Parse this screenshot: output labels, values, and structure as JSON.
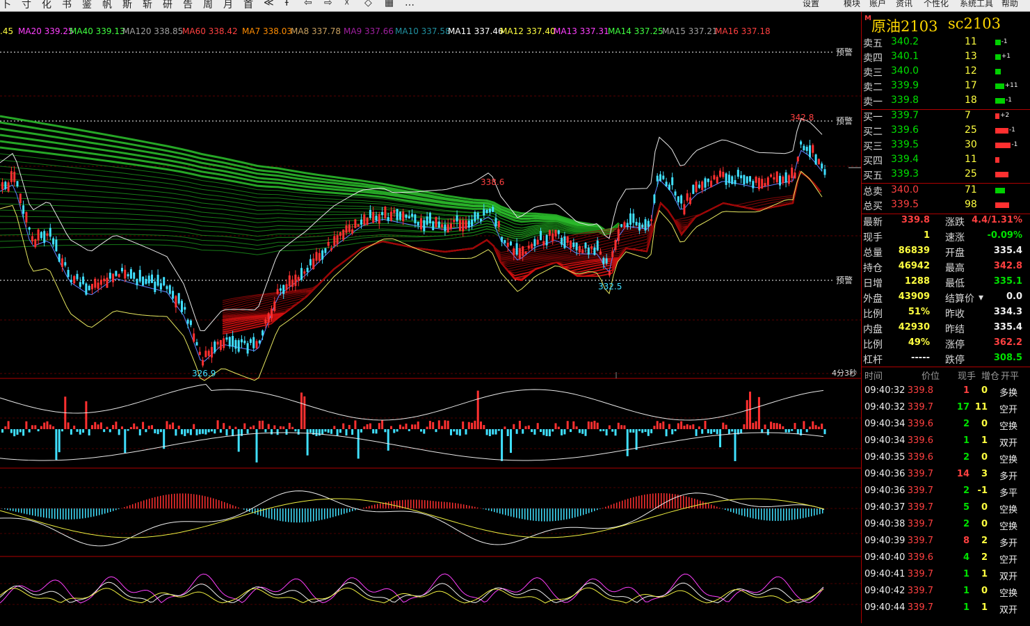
{
  "toolbar": {
    "items": [
      "卜",
      "寸",
      "化",
      "书",
      "鉴",
      "帆",
      "斯",
      "斩",
      "研",
      "告",
      "周",
      "月",
      "首",
      "≪",
      "Ŧ",
      "⇦",
      "⇨",
      "☓",
      "◇",
      "▦",
      "…"
    ],
    "right_items": [
      "设置",
      "模块",
      "账户",
      "资讯",
      "个性化",
      "系统工具",
      "帮助"
    ]
  },
  "ma_legend": [
    {
      "label": ".45",
      "color": "#ffff40"
    },
    {
      "label": "MA20 339.25",
      "color": "#ff40ff"
    },
    {
      "label": "MA40 339.13",
      "color": "#40ff40"
    },
    {
      "label": "MA120 338.85",
      "color": "#a0a0a0"
    },
    {
      "label": "MA60 338.42",
      "color": "#ff4040"
    },
    {
      "label": "MA7 338.03",
      "color": "#ff8c00"
    },
    {
      "label": "MA8 337.78",
      "color": "#c8a060"
    },
    {
      "label": "MA9 337.66",
      "color": "#a020a0"
    },
    {
      "label": "MA10 337.58",
      "color": "#2090a0"
    },
    {
      "label": "MA11 337.46",
      "color": "#ffffff"
    },
    {
      "label": "MA12 337.40",
      "color": "#ffff40"
    },
    {
      "label": "MA13 337.31",
      "color": "#ff40ff"
    },
    {
      "label": "MA14 337.25",
      "color": "#40ff40"
    },
    {
      "label": "MA15 337.21",
      "color": "#a0a0a0"
    },
    {
      "label": "MA16 337.18",
      "color": "#ff4040"
    }
  ],
  "chart_labels": {
    "warn": "预警",
    "high": "342.8",
    "peak_mid": "338.6",
    "low_mid": "332.5",
    "low": "326.9",
    "timer": "4分3秒"
  },
  "quote": {
    "marker": "M",
    "name": "原油2103",
    "code": "sc2103",
    "asks": [
      {
        "label": "卖五",
        "price": "340.2",
        "qty": "11",
        "chg": "-1",
        "bar": 0.15
      },
      {
        "label": "卖四",
        "price": "340.1",
        "qty": "13",
        "chg": "+1",
        "bar": 0.15
      },
      {
        "label": "卖三",
        "price": "340.0",
        "qty": "12",
        "chg": "",
        "bar": 0.15
      },
      {
        "label": "卖二",
        "price": "339.9",
        "qty": "17",
        "chg": "+11",
        "bar": 0.25
      },
      {
        "label": "卖一",
        "price": "339.8",
        "qty": "18",
        "chg": "-1",
        "bar": 0.28
      }
    ],
    "bids": [
      {
        "label": "买一",
        "price": "339.7",
        "qty": "7",
        "chg": "+2",
        "bar": 0.12
      },
      {
        "label": "买二",
        "price": "339.6",
        "qty": "25",
        "chg": "-1",
        "bar": 0.38
      },
      {
        "label": "买三",
        "price": "339.5",
        "qty": "30",
        "chg": "-1",
        "bar": 0.46
      },
      {
        "label": "买四",
        "price": "339.4",
        "qty": "11",
        "chg": "",
        "bar": 0.12
      },
      {
        "label": "买五",
        "price": "339.3",
        "qty": "25",
        "chg": "",
        "bar": 0.38
      }
    ],
    "total_sell": {
      "label": "总卖",
      "price": "340.0",
      "qty": "71",
      "bar": 0.28
    },
    "total_buy": {
      "label": "总买",
      "price": "339.5",
      "qty": "98",
      "bar": 0.4
    },
    "stats": [
      {
        "l1": "最新",
        "v1": "339.8",
        "c1": "red",
        "l2": "涨跌",
        "v2": "4.4/1.31%",
        "c2": "red"
      },
      {
        "l1": "现手",
        "v1": "1",
        "c1": "yel",
        "l2": "速涨",
        "v2": "-0.09%",
        "c2": "green"
      },
      {
        "l1": "总量",
        "v1": "86839",
        "c1": "yel",
        "l2": "开盘",
        "v2": "335.4",
        "c2": "wht"
      },
      {
        "l1": "持仓",
        "v1": "46942",
        "c1": "yel",
        "l2": "最高",
        "v2": "342.8",
        "c2": "red"
      },
      {
        "l1": "日增",
        "v1": "1288",
        "c1": "yel",
        "l2": "最低",
        "v2": "335.1",
        "c2": "green"
      },
      {
        "l1": "外盘",
        "v1": "43909",
        "c1": "yel",
        "l2": "结算价",
        "v2": "0.0",
        "c2": "wht"
      },
      {
        "l1": "比例",
        "v1": "51%",
        "c1": "yel",
        "l2": "昨收",
        "v2": "334.3",
        "c2": "wht"
      },
      {
        "l1": "内盘",
        "v1": "42930",
        "c1": "yel",
        "l2": "昨结",
        "v2": "335.4",
        "c2": "wht"
      },
      {
        "l1": "比例",
        "v1": "49%",
        "c1": "yel",
        "l2": "涨停",
        "v2": "362.2",
        "c2": "red"
      },
      {
        "l1": "杠杆",
        "v1": "-----",
        "c1": "wht",
        "l2": "跌停",
        "v2": "308.5",
        "c2": "green"
      }
    ],
    "ticks_header": [
      "时间",
      "价位",
      "现手",
      "增仓",
      "开平"
    ],
    "ticks": [
      {
        "t": "09:40:32",
        "p": "339.8",
        "pc": "red",
        "v": "1",
        "vc": "red",
        "d": "0",
        "dc": "yel",
        "k": "多换"
      },
      {
        "t": "09:40:32",
        "p": "339.7",
        "pc": "red",
        "v": "17",
        "vc": "green",
        "d": "11",
        "dc": "yel",
        "k": "空开"
      },
      {
        "t": "09:40:34",
        "p": "339.6",
        "pc": "red",
        "v": "2",
        "vc": "green",
        "d": "0",
        "dc": "yel",
        "k": "空换"
      },
      {
        "t": "09:40:34",
        "p": "339.6",
        "pc": "red",
        "v": "1",
        "vc": "green",
        "d": "1",
        "dc": "yel",
        "k": "双开"
      },
      {
        "t": "09:40:35",
        "p": "339.6",
        "pc": "red",
        "v": "2",
        "vc": "green",
        "d": "0",
        "dc": "yel",
        "k": "空换"
      },
      {
        "t": "09:40:36",
        "p": "339.7",
        "pc": "red",
        "v": "14",
        "vc": "red",
        "d": "3",
        "dc": "yel",
        "k": "多开"
      },
      {
        "t": "09:40:36",
        "p": "339.7",
        "pc": "red",
        "v": "2",
        "vc": "green",
        "d": "-1",
        "dc": "yel",
        "k": "多平"
      },
      {
        "t": "09:40:37",
        "p": "339.7",
        "pc": "red",
        "v": "5",
        "vc": "green",
        "d": "0",
        "dc": "yel",
        "k": "空换"
      },
      {
        "t": "09:40:38",
        "p": "339.7",
        "pc": "red",
        "v": "2",
        "vc": "green",
        "d": "0",
        "dc": "yel",
        "k": "空换"
      },
      {
        "t": "09:40:39",
        "p": "339.7",
        "pc": "red",
        "v": "8",
        "vc": "red",
        "d": "2",
        "dc": "yel",
        "k": "多开"
      },
      {
        "t": "09:40:40",
        "p": "339.6",
        "pc": "red",
        "v": "4",
        "vc": "green",
        "d": "2",
        "dc": "yel",
        "k": "空开"
      },
      {
        "t": "09:40:41",
        "p": "339.7",
        "pc": "red",
        "v": "1",
        "vc": "green",
        "d": "1",
        "dc": "yel",
        "k": "双开"
      },
      {
        "t": "09:40:42",
        "p": "339.7",
        "pc": "red",
        "v": "1",
        "vc": "green",
        "d": "0",
        "dc": "yel",
        "k": "空换"
      },
      {
        "t": "09:40:44",
        "p": "339.7",
        "pc": "red",
        "v": "1",
        "vc": "green",
        "d": "1",
        "dc": "yel",
        "k": "双开"
      }
    ]
  }
}
